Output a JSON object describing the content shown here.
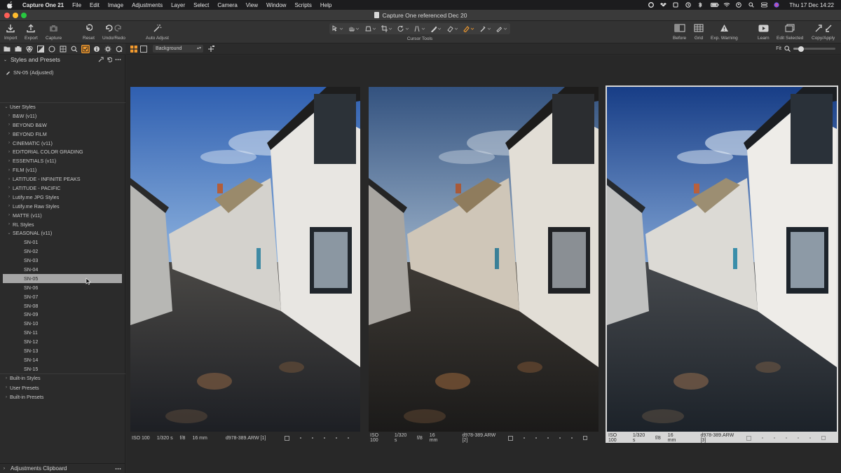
{
  "menubar": {
    "app_name": "Capture One 21",
    "menus": [
      "File",
      "Edit",
      "Image",
      "Adjustments",
      "Layer",
      "Select",
      "Camera",
      "View",
      "Window",
      "Scripts",
      "Help"
    ],
    "clock": "Thu 17 Dec  14:22"
  },
  "window": {
    "title": "Capture One referenced Dec 20"
  },
  "toolbar": {
    "import": "Import",
    "export": "Export",
    "capture": "Capture",
    "reset": "Reset",
    "undo_redo": "Undo/Redo",
    "auto_adjust": "Auto Adjust",
    "cursor_tools": "Cursor Tools",
    "before": "Before",
    "grid": "Grid",
    "exp_warning": "Exp. Warning",
    "learn": "Learn",
    "edit_selected": "Edit Selected",
    "copy_apply": "Copy/Apply"
  },
  "viewer_bar": {
    "background_select": "Background",
    "fit_label": "Fit",
    "zoom_level": 0.18
  },
  "styles_panel": {
    "title": "Styles and Presets",
    "applied": "SN-05 (Adjusted)",
    "user_styles_label": "User Styles",
    "style_groups": [
      "B&W (v11)",
      "BEYOND B&W",
      "BEYOND FILM",
      "CINEMATIC (v11)",
      "EDITORIAL COLOR GRADING",
      "ESSENTIALS (v11)",
      "FILM (v11)",
      "LATITUDE - INFINITE PEAKS",
      "LATITUDE - PACIFIC",
      "Lutify.me JPG Styles",
      "Lutify.me Raw Styles",
      "MATTE (v11)",
      "RL Styles"
    ],
    "expanded_group": "SEASONAL (v11)",
    "seasonal_items": [
      "SN-01",
      "SN-02",
      "SN-03",
      "SN-04",
      "SN-05",
      "SN-06",
      "SN-07",
      "SN-08",
      "SN-09",
      "SN-10",
      "SN-11",
      "SN-12",
      "SN-13",
      "SN-14",
      "SN-15"
    ],
    "selected_item": "SN-05",
    "bottom_groups": [
      "Built-in Styles",
      "User Presets",
      "Built-in Presets"
    ]
  },
  "clipboard_panel": {
    "title": "Adjustments Clipboard"
  },
  "images": [
    {
      "iso": "ISO 100",
      "shutter": "1/320 s",
      "aperture": "f/8",
      "focal": "16 mm",
      "file": "d978-389.ARW [1]"
    },
    {
      "iso": "ISO 100",
      "shutter": "1/320 s",
      "aperture": "f/8",
      "focal": "16 mm",
      "file": "d978-389.ARW [2]"
    },
    {
      "iso": "ISO 100",
      "shutter": "1/320 s",
      "aperture": "f/8",
      "focal": "16 mm",
      "file": "d978-389.ARW [3]"
    }
  ],
  "colors": {
    "accent": "#f29a2e",
    "panel": "#2b2b2b",
    "selection": "#a6a6a6"
  }
}
